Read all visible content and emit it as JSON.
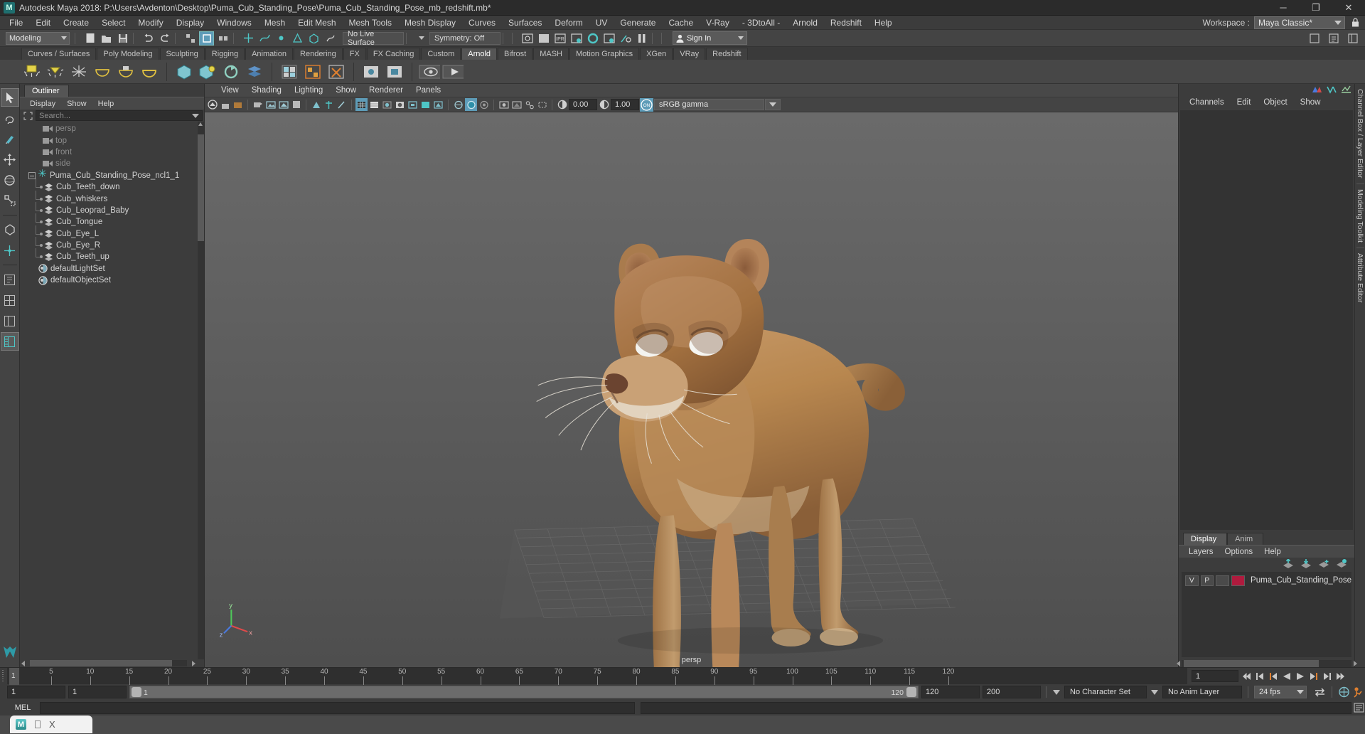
{
  "window": {
    "title": "Autodesk Maya 2018: P:\\Users\\Avdenton\\Desktop\\Puma_Cub_Standing_Pose\\Puma_Cub_Standing_Pose_mb_redshift.mb*",
    "app_icon": "maya-icon",
    "minimize": "─",
    "maximize": "❐",
    "close": "✕"
  },
  "menubar": {
    "items": [
      "File",
      "Edit",
      "Create",
      "Select",
      "Modify",
      "Display",
      "Windows",
      "Mesh",
      "Edit Mesh",
      "Mesh Tools",
      "Mesh Display",
      "Curves",
      "Surfaces",
      "Deform",
      "UV",
      "Generate",
      "Cache",
      "V-Ray",
      "- 3DtoAll -",
      "Arnold",
      "Redshift",
      "Help"
    ],
    "workspace_label": "Workspace :",
    "workspace_value": "Maya Classic*"
  },
  "statusline": {
    "mode": "Modeling",
    "live_surface": "No Live Surface",
    "symmetry": "Symmetry: Off",
    "signin": "Sign In"
  },
  "shelf": {
    "tabs": [
      "Curves / Surfaces",
      "Poly Modeling",
      "Sculpting",
      "Rigging",
      "Animation",
      "Rendering",
      "FX",
      "FX Caching",
      "Custom",
      "Arnold",
      "Bifrost",
      "MASH",
      "Motion Graphics",
      "XGen",
      "VRay",
      "Redshift"
    ],
    "active_tab": "Arnold"
  },
  "outliner": {
    "tab": "Outliner",
    "menu": [
      "Display",
      "Show",
      "Help"
    ],
    "search_placeholder": "Search...",
    "items": [
      {
        "label": "persp",
        "type": "camera",
        "dim": true,
        "indent": 1
      },
      {
        "label": "top",
        "type": "camera",
        "dim": true,
        "indent": 1
      },
      {
        "label": "front",
        "type": "camera",
        "dim": true,
        "indent": 1
      },
      {
        "label": "side",
        "type": "camera",
        "dim": true,
        "indent": 1
      },
      {
        "label": "Puma_Cub_Standing_Pose_ncl1_1",
        "type": "group",
        "dim": false,
        "indent": 0
      },
      {
        "label": "Cub_Teeth_down",
        "type": "mesh",
        "dim": false,
        "indent": 1
      },
      {
        "label": "Cub_whiskers",
        "type": "mesh",
        "dim": false,
        "indent": 1
      },
      {
        "label": "Cub_Leoprad_Baby",
        "type": "mesh",
        "dim": false,
        "indent": 1
      },
      {
        "label": "Cub_Tongue",
        "type": "mesh",
        "dim": false,
        "indent": 1
      },
      {
        "label": "Cub_Eye_L",
        "type": "mesh",
        "dim": false,
        "indent": 1
      },
      {
        "label": "Cub_Eye_R",
        "type": "mesh",
        "dim": false,
        "indent": 1
      },
      {
        "label": "Cub_Teeth_up",
        "type": "mesh",
        "dim": false,
        "indent": 1
      },
      {
        "label": "defaultLightSet",
        "type": "set",
        "dim": false,
        "indent": 1
      },
      {
        "label": "defaultObjectSet",
        "type": "set",
        "dim": false,
        "indent": 1
      }
    ]
  },
  "viewport": {
    "menu": [
      "View",
      "Shading",
      "Lighting",
      "Show",
      "Renderer",
      "Panels"
    ],
    "exposure": "0.00",
    "gamma_value": "1.00",
    "color_space": "sRGB gamma",
    "camera_label": "persp",
    "axis_x": "x",
    "axis_y": "y",
    "axis_z": "z"
  },
  "channelbox": {
    "tabs": [
      "Channels",
      "Edit",
      "Object",
      "Show"
    ]
  },
  "layer_editor": {
    "tabs": [
      "Display",
      "Anim"
    ],
    "active_tab": "Display",
    "menu": [
      "Layers",
      "Options",
      "Help"
    ],
    "layers": [
      {
        "visibility": "V",
        "playback": "P",
        "shading": "",
        "color": "#b01b3e",
        "name": "Puma_Cub_Standing_Pose"
      }
    ]
  },
  "vertical_tabs": [
    "Channel Box / Layer Editor",
    "Modeling Toolkit",
    "Attribute Editor"
  ],
  "timeline": {
    "current_frame": "1",
    "ticks": [
      5,
      10,
      15,
      20,
      25,
      30,
      35,
      40,
      45,
      50,
      55,
      60,
      65,
      70,
      75,
      80,
      85,
      90,
      95,
      100,
      105,
      110,
      115,
      120
    ],
    "start": 1,
    "end": 120,
    "frame_field": "1"
  },
  "range": {
    "anim_start": "1",
    "range_start": "1",
    "slider_left": "1",
    "slider_right": "120",
    "range_end": "120",
    "anim_end": "200",
    "character_set": "No Character Set",
    "anim_layer": "No Anim Layer",
    "fps": "24 fps"
  },
  "mel": {
    "label": "MEL",
    "input": "",
    "output": ""
  },
  "taskbar": {
    "app": "M",
    "close": "X"
  },
  "colors": {
    "accent_cyan": "#4ec7c7",
    "accent_blue": "#5e9cb8",
    "layer_color": "#b01b3e",
    "orange": "#e08030",
    "bg_panel": "#3c3c3c",
    "bg_dark": "#2e2e2e"
  }
}
